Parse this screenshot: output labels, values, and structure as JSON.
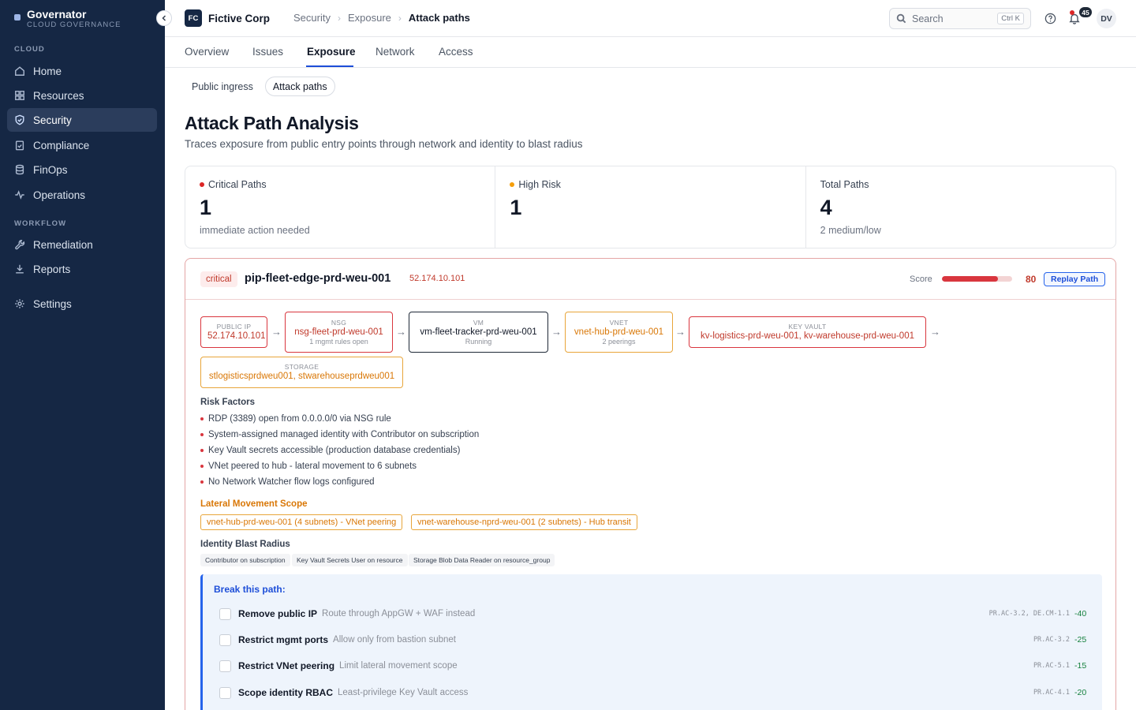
{
  "app": {
    "name": "Governator",
    "subtitle": "CLOUD GOVERNANCE"
  },
  "sidebar": {
    "sections": [
      {
        "label": "CLOUD"
      },
      {
        "label": "WORKFLOW"
      }
    ],
    "items": [
      {
        "label": "Home",
        "icon": "home-icon"
      },
      {
        "label": "Resources",
        "icon": "grid-icon"
      },
      {
        "label": "Security",
        "icon": "shield-icon",
        "active": true
      },
      {
        "label": "Compliance",
        "icon": "clipboard-check-icon"
      },
      {
        "label": "FinOps",
        "icon": "database-icon"
      },
      {
        "label": "Operations",
        "icon": "activity-icon"
      },
      {
        "label": "Remediation",
        "icon": "wrench-icon"
      },
      {
        "label": "Reports",
        "icon": "download-icon"
      },
      {
        "label": "Settings",
        "icon": "gear-icon"
      }
    ]
  },
  "header": {
    "org_badge": "FC",
    "org_name": "Fictive Corp",
    "breadcrumb": [
      "Security",
      "Exposure",
      "Attack paths"
    ],
    "search_placeholder": "Search",
    "search_shortcut": "Ctrl K",
    "notifications_count": "45",
    "user_initials": "DV"
  },
  "tabs": [
    "Overview",
    "Issues",
    "Exposure",
    "Network",
    "Access"
  ],
  "active_tab": "Exposure",
  "subtabs": [
    "Public ingress",
    "Attack paths"
  ],
  "active_subtab": "Attack paths",
  "page": {
    "title": "Attack Path Analysis",
    "subtitle": "Traces exposure from public entry points through network and identity to blast radius"
  },
  "stats": [
    {
      "label": "Critical Paths",
      "value": "1",
      "note": "immediate action needed",
      "color": "#dc2626"
    },
    {
      "label": "High Risk",
      "value": "1",
      "note": "",
      "color": "#f59e0b"
    },
    {
      "label": "Total Paths",
      "value": "4",
      "note": "2 medium/low"
    }
  ],
  "path": {
    "severity": "critical",
    "name": "pip-fleet-edge-prd-weu-001",
    "ip": "52.174.10.101",
    "score_label": "Score",
    "score": "80",
    "score_fraction": 0.8,
    "replay_label": "Replay Path",
    "nodes": [
      {
        "type": "PUBLIC IP",
        "name": "52.174.10.101",
        "note": ""
      },
      {
        "type": "NSG",
        "name": "nsg-fleet-prd-weu-001",
        "note": "1 mgmt rules open"
      },
      {
        "type": "VM",
        "name": "vm-fleet-tracker-prd-weu-001",
        "note": "Running"
      },
      {
        "type": "VNET",
        "name": "vnet-hub-prd-weu-001",
        "note": "2 peerings"
      },
      {
        "type": "KEY VAULT",
        "name": "kv-logistics-prd-weu-001, kv-warehouse-prd-weu-001",
        "note": ""
      },
      {
        "type": "STORAGE",
        "name": "stlogisticsprdweu001, stwarehouseprdweu001",
        "note": ""
      }
    ],
    "arrow": "→",
    "risk_title": "Risk Factors",
    "risks": [
      "RDP (3389) open from 0.0.0.0/0 via NSG rule",
      "System-assigned managed identity with Contributor on subscription",
      "Key Vault secrets accessible (production database credentials)",
      "VNet peered to hub - lateral movement to 6 subnets",
      "No Network Watcher flow logs configured"
    ],
    "lateral_title": "Lateral Movement Scope",
    "lateral": [
      "vnet-hub-prd-weu-001 (4 subnets) - VNet peering",
      "vnet-warehouse-nprd-weu-001 (2 subnets) - Hub transit"
    ],
    "identity_title": "Identity Blast Radius",
    "identity": [
      "Contributor on subscription",
      "Key Vault Secrets User on resource",
      "Storage Blob Data Reader on resource_group"
    ],
    "break_title": "Break this path:",
    "fixes": [
      {
        "title": "Remove public IP",
        "desc": "Route through AppGW + WAF instead",
        "controls": "PR.AC-3.2, DE.CM-1.1",
        "delta": "-40"
      },
      {
        "title": "Restrict mgmt ports",
        "desc": "Allow only from bastion subnet",
        "controls": "PR.AC-3.2",
        "delta": "-25"
      },
      {
        "title": "Restrict VNet peering",
        "desc": "Limit lateral movement scope",
        "controls": "PR.AC-5.1",
        "delta": "-15"
      },
      {
        "title": "Scope identity RBAC",
        "desc": "Least-privilege Key Vault access",
        "controls": "PR.AC-4.1",
        "delta": "-20"
      }
    ]
  }
}
